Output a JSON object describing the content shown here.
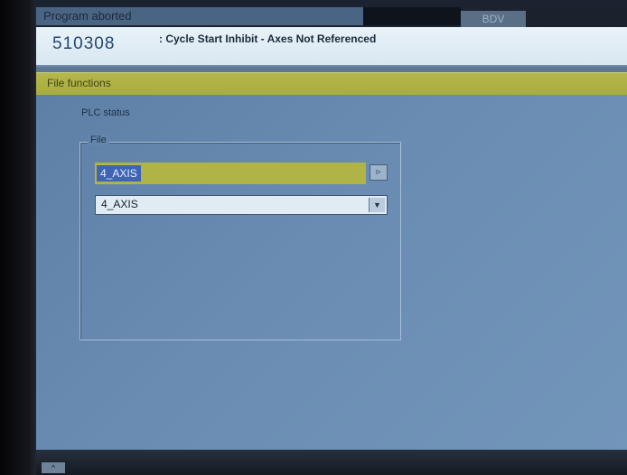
{
  "status_bar": {
    "program_state": "Program aborted",
    "channel": "BDV"
  },
  "alarm": {
    "number": "510308",
    "message": ": Cycle Start Inhibit - Axes Not Referenced"
  },
  "section": {
    "title": "File functions"
  },
  "main": {
    "plc_label": "PLC status",
    "file_group": {
      "label": "File",
      "name_value": "4_AXIS",
      "browse_icon": "browse-icon",
      "select_value": "4_AXIS",
      "select_icon": "chevron-down-icon"
    }
  },
  "bottom": {
    "softkey_label": "^"
  },
  "colors": {
    "section_header": "#b0b346",
    "panel_background": "#6486ab",
    "alarm_background": "#e2edf5",
    "selection_highlight": "#3f64b6"
  }
}
